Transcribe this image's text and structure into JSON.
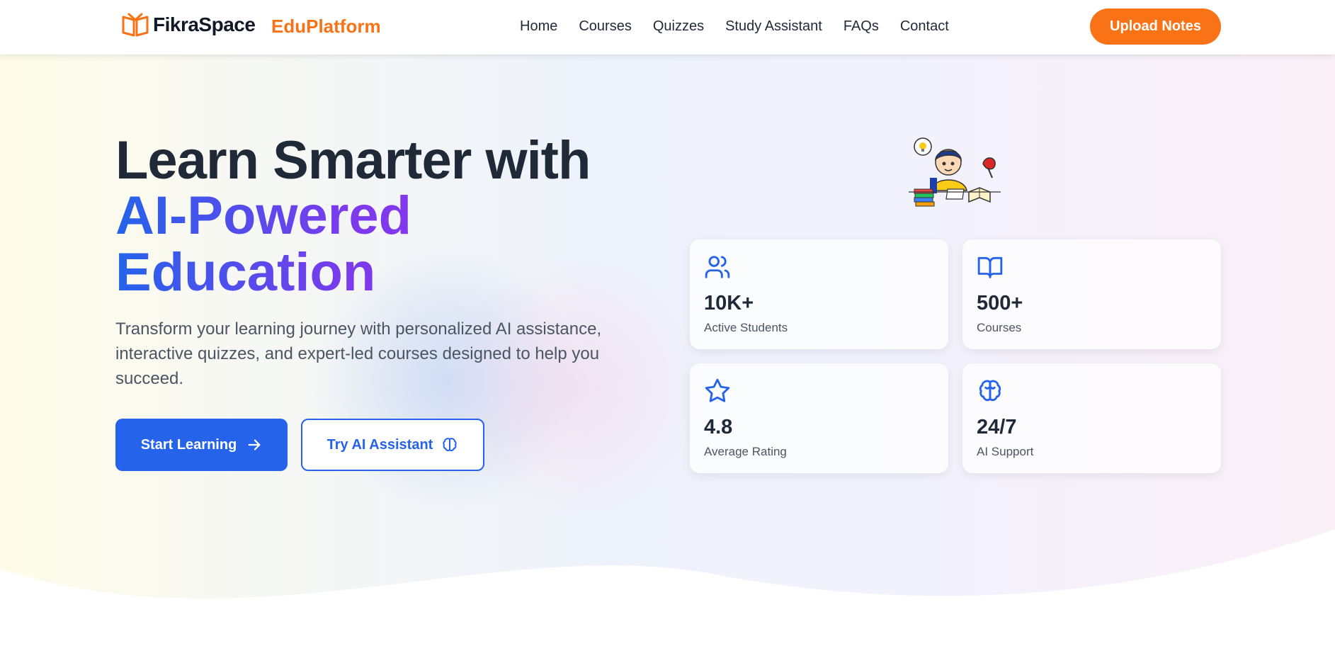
{
  "header": {
    "logo_text": "FikraSpace",
    "brand_secondary": "EduPlatform",
    "nav": [
      "Home",
      "Courses",
      "Quizzes",
      "Study Assistant",
      "FAQs",
      "Contact"
    ],
    "cta_label": "Upload Notes"
  },
  "hero": {
    "title_line1": "Learn Smarter with",
    "title_highlight": "AI-Powered Education",
    "description": "Transform your learning journey with personalized AI assistance, interactive quizzes, and expert-led courses designed to help you succeed.",
    "primary_button": "Start Learning",
    "secondary_button": "Try AI Assistant"
  },
  "stats": [
    {
      "icon": "users-icon",
      "value": "10K+",
      "label": "Active Students"
    },
    {
      "icon": "book-open-icon",
      "value": "500+",
      "label": "Courses"
    },
    {
      "icon": "star-icon",
      "value": "4.8",
      "label": "Average Rating"
    },
    {
      "icon": "brain-icon",
      "value": "24/7",
      "label": "AI Support"
    }
  ],
  "colors": {
    "accent_orange": "#f97316",
    "primary_blue": "#2563eb",
    "gradient_purple": "#9333ea",
    "heading_dark": "#1f2937"
  }
}
